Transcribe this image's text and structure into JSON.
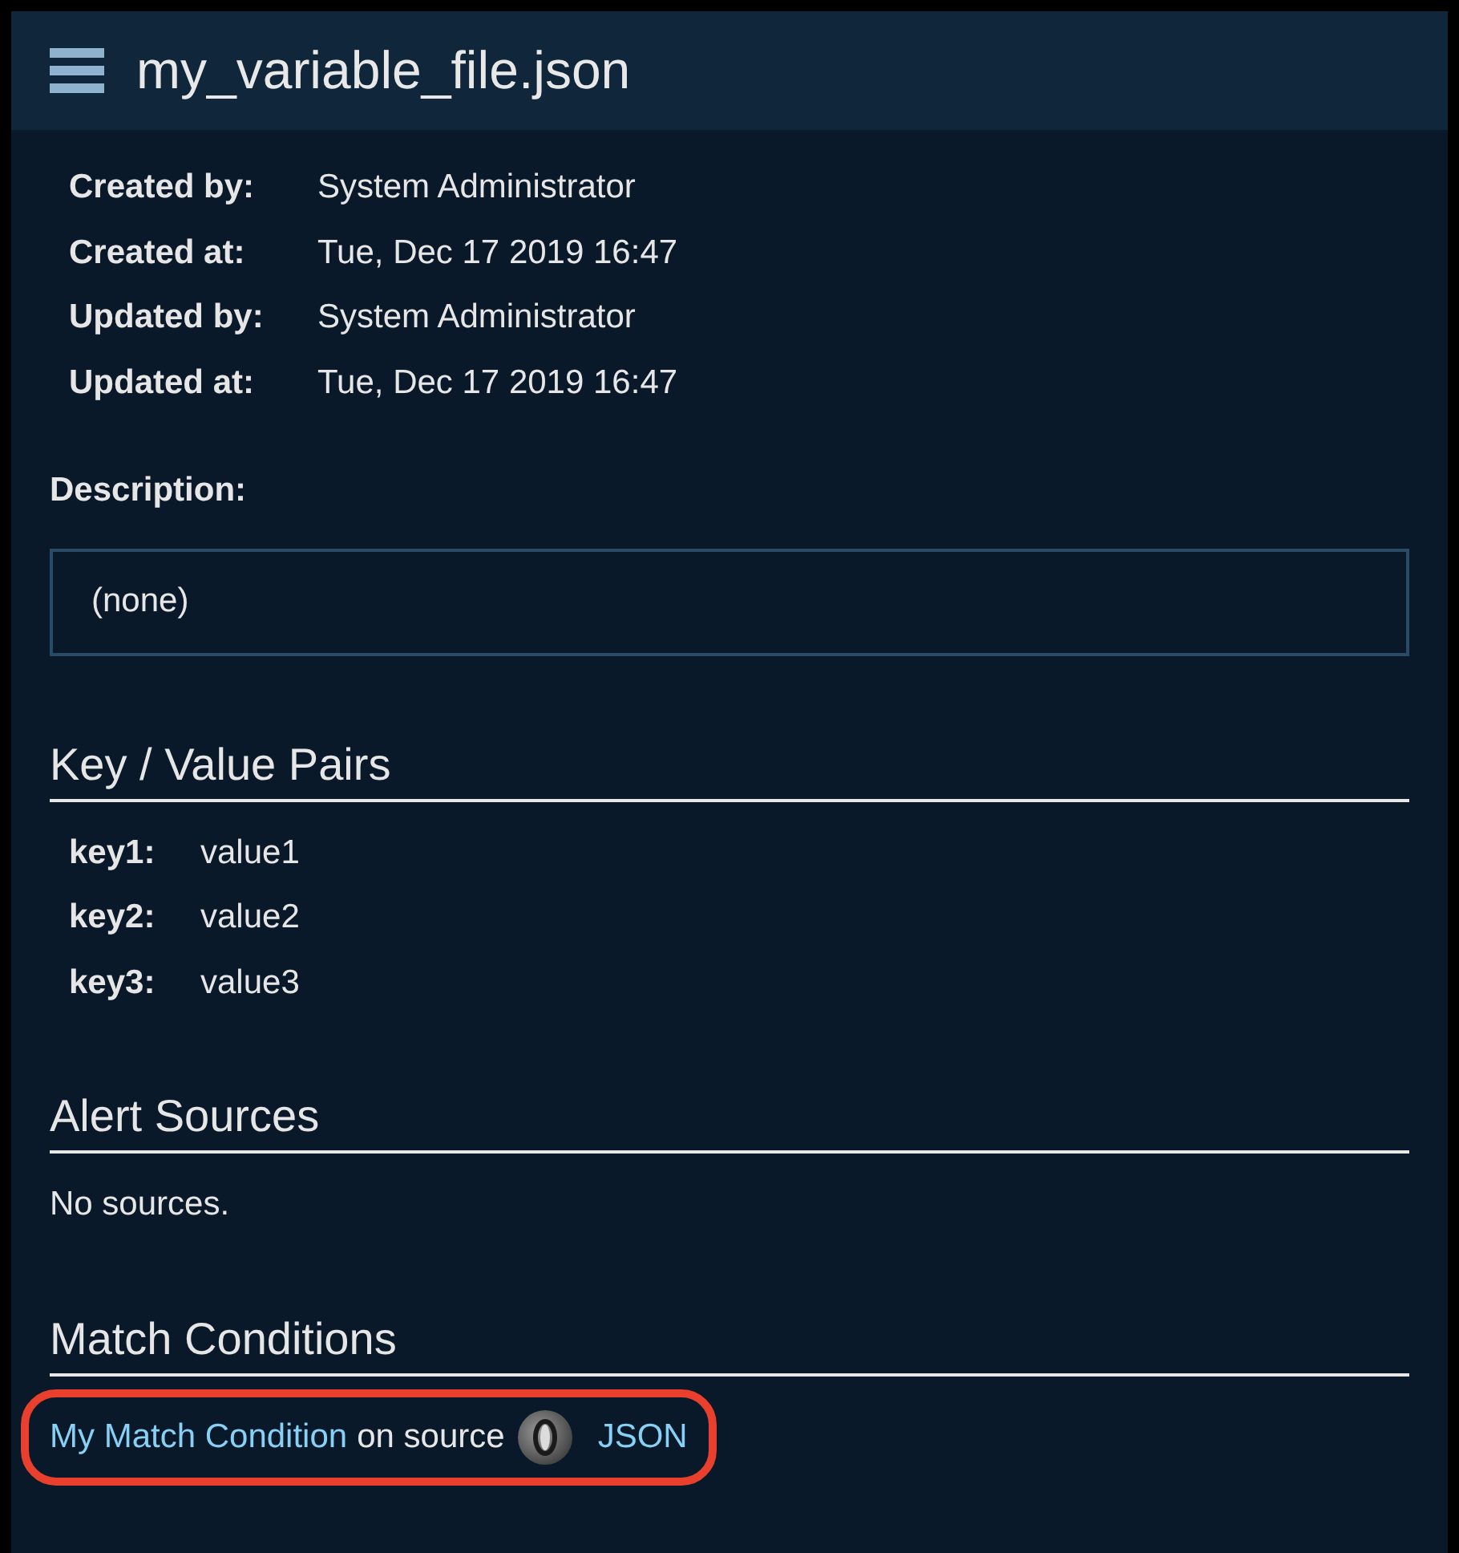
{
  "header": {
    "title": "my_variable_file.json"
  },
  "meta": [
    {
      "label": "Created by:",
      "value": "System Administrator"
    },
    {
      "label": "Created at:",
      "value": "Tue, Dec 17 2019 16:47"
    },
    {
      "label": "Updated by:",
      "value": "System Administrator"
    },
    {
      "label": "Updated at:",
      "value": "Tue, Dec 17 2019 16:47"
    }
  ],
  "description": {
    "label": "Description:",
    "value": "(none)"
  },
  "key_values": {
    "heading": "Key / Value Pairs",
    "pairs": [
      {
        "key": "key1:",
        "value": "value1"
      },
      {
        "key": "key2:",
        "value": "value2"
      },
      {
        "key": "key3:",
        "value": "value3"
      }
    ]
  },
  "alert_sources": {
    "heading": "Alert Sources",
    "empty_text": "No sources."
  },
  "match_conditions": {
    "heading": "Match Conditions",
    "items": [
      {
        "name": "My Match Condition",
        "connector": "on source",
        "source": "JSON",
        "highlighted": true
      }
    ]
  }
}
